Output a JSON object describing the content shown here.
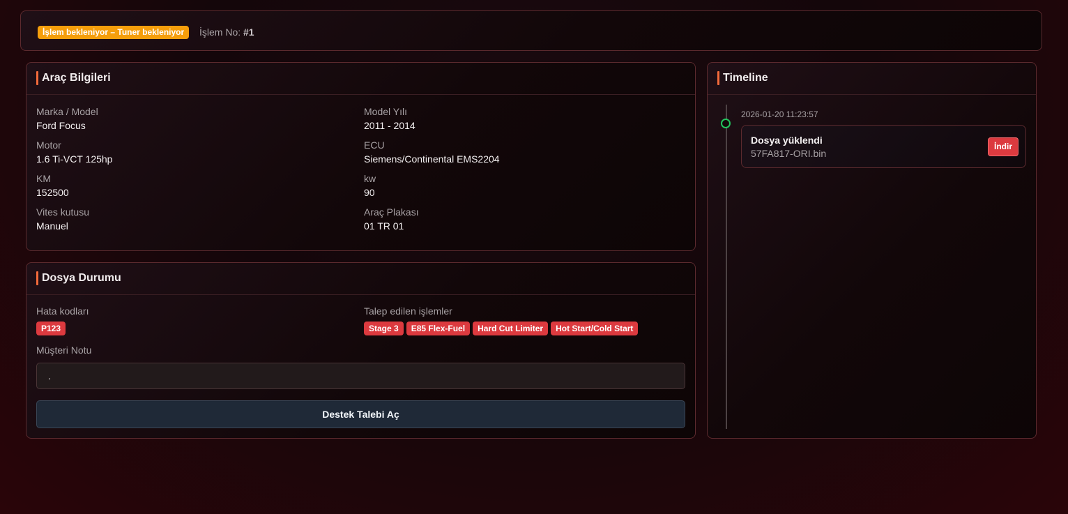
{
  "header": {
    "status_badge": "İşlem bekleniyor – Tuner bekleniyor",
    "job_label": "İşlem No:",
    "job_number": "#1",
    "status_color": "#f59e0b"
  },
  "vehicle": {
    "title": "Araç Bilgileri",
    "fields": [
      {
        "label": "Marka / Model",
        "value": "Ford Focus"
      },
      {
        "label": "Model Yılı",
        "value": "2011 - 2014"
      },
      {
        "label": "Motor",
        "value": "1.6 Ti-VCT 125hp"
      },
      {
        "label": "ECU",
        "value": "Siemens/Continental EMS2204"
      },
      {
        "label": "KM",
        "value": "152500"
      },
      {
        "label": "kw",
        "value": "90"
      },
      {
        "label": "Vites kutusu",
        "value": "Manuel"
      },
      {
        "label": "Araç Plakası",
        "value": "01 TR 01"
      }
    ]
  },
  "file_status": {
    "title": "Dosya Durumu",
    "error_codes_label": "Hata kodları",
    "error_codes": [
      "P123"
    ],
    "requests_label": "Talep edilen işlemler",
    "requests": [
      "Stage 3",
      "E85 Flex-Fuel",
      "Hard Cut Limiter",
      "Hot Start/Cold Start"
    ],
    "note_label": "Müşteri Notu",
    "note_value": ".",
    "support_button": "Destek Talebi Aç"
  },
  "timeline": {
    "title": "Timeline",
    "events": [
      {
        "time": "2026-01-20 11:23:57",
        "title": "Dosya yüklendi",
        "file": "57FA817-ORI.bin",
        "action": "İndir"
      }
    ]
  },
  "colors": {
    "accent": "#f26a3b",
    "chip": "#dc3a3f",
    "dot": "#22c55e"
  }
}
